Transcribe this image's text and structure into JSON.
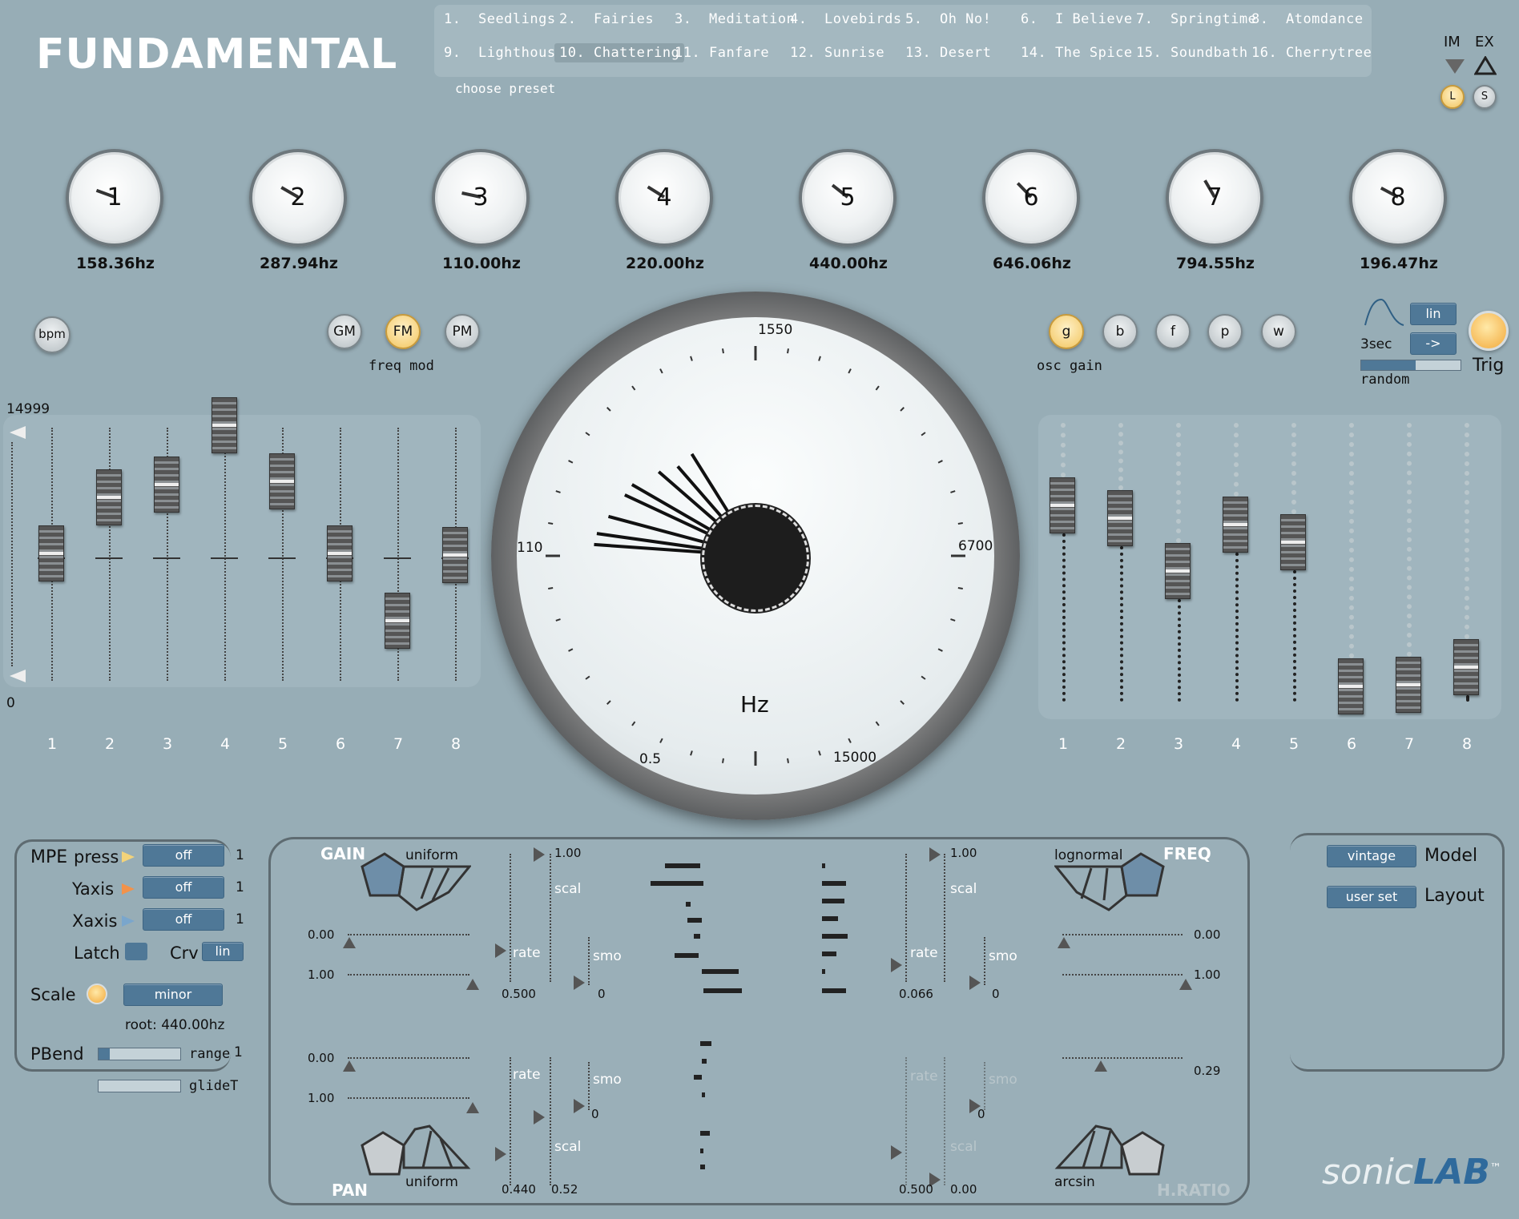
{
  "app": {
    "title": "FUNDAMENTAL",
    "brand_a": "sonic",
    "brand_b": "LAB",
    "brand_tm": "™"
  },
  "presets": {
    "items": [
      {
        "num": "1.",
        "name": "Seedlings"
      },
      {
        "num": "2.",
        "name": "Fairies"
      },
      {
        "num": "3.",
        "name": "Meditation"
      },
      {
        "num": "4.",
        "name": "Lovebirds"
      },
      {
        "num": "5.",
        "name": "Oh No!"
      },
      {
        "num": "6.",
        "name": "I Believe"
      },
      {
        "num": "7.",
        "name": "Springtime"
      },
      {
        "num": "8.",
        "name": "Atomdance"
      },
      {
        "num": "9.",
        "name": "Lighthouse"
      },
      {
        "num": "10.",
        "name": "Chattering"
      },
      {
        "num": "11.",
        "name": "Fanfare"
      },
      {
        "num": "12.",
        "name": "Sunrise"
      },
      {
        "num": "13.",
        "name": "Desert"
      },
      {
        "num": "14.",
        "name": "The Spice"
      },
      {
        "num": "15.",
        "name": "Soundbath"
      },
      {
        "num": "16.",
        "name": "Cherrytree"
      }
    ],
    "selected": "10. Chattering",
    "choose_label": "choose preset"
  },
  "import_export": {
    "im": "IM",
    "ex": "EX",
    "load": "L",
    "save": "S"
  },
  "oscillators": [
    {
      "label": "1",
      "freq": "158.36hz"
    },
    {
      "label": "2",
      "freq": "287.94hz"
    },
    {
      "label": "3",
      "freq": "110.00hz"
    },
    {
      "label": "4",
      "freq": "220.00hz"
    },
    {
      "label": "5",
      "freq": "440.00hz"
    },
    {
      "label": "6",
      "freq": "646.06hz"
    },
    {
      "label": "7",
      "freq": "794.55hz"
    },
    {
      "label": "8",
      "freq": "196.47hz"
    }
  ],
  "buttons": {
    "bpm": "bpm",
    "gm": "GM",
    "fm": "FM",
    "pm": "PM",
    "freq_mod": "freq mod",
    "g": "g",
    "b": "b",
    "f": "f",
    "p": "p",
    "w": "w",
    "osc_gain": "osc gain"
  },
  "trigger": {
    "curve": "lin",
    "time": "3sec",
    "arrow": "->",
    "random": "random",
    "trig": "Trig",
    "random_level": 0.55
  },
  "freq_sliders": {
    "max": "14999",
    "min": "0",
    "labels": [
      "1",
      "2",
      "3",
      "4",
      "5",
      "6",
      "7",
      "8"
    ]
  },
  "gain_sliders": {
    "labels": [
      "1",
      "2",
      "3",
      "4",
      "5",
      "6",
      "7",
      "8"
    ]
  },
  "dial": {
    "unit": "Hz",
    "tick_1550": "1550",
    "tick_110": "110",
    "tick_6700": "6700",
    "tick_05": "0.5",
    "tick_15000": "15000"
  },
  "mpe": {
    "title": "MPE",
    "press": "press",
    "yaxis": "Yaxis",
    "xaxis": "Xaxis",
    "press_val": "off",
    "yaxis_val": "off",
    "xaxis_val": "off",
    "press_num": "1",
    "yaxis_num": "1",
    "xaxis_num": "1",
    "latch": "Latch",
    "crv": "Crv",
    "crv_val": "lin",
    "scale": "Scale",
    "scale_val": "minor",
    "root": "root: 440.00hz",
    "pbend": "PBend",
    "range": "range",
    "range_val": "1",
    "glide": "glideT"
  },
  "model": {
    "model_val": "vintage",
    "model_label": "Model",
    "layout_val": "user set",
    "layout_label": "Layout"
  },
  "gain_section": {
    "label": "GAIN",
    "dist": "uniform",
    "scal_val": "1.00",
    "scal": "scal",
    "min": "0.00",
    "max": "1.00",
    "rate": "rate",
    "rate_val": "0.500",
    "smo": "smo",
    "smo_val": "0"
  },
  "freq_section": {
    "label": "FREQ",
    "dist": "lognormal",
    "scal_val": "1.00",
    "scal": "scal",
    "min": "0.00",
    "max": "1.00",
    "rate": "rate",
    "rate_val": "0.066",
    "smo": "smo",
    "smo_val": "0"
  },
  "pan_section": {
    "label": "PAN",
    "dist": "uniform",
    "min": "0.00",
    "max": "1.00",
    "rate": "rate",
    "smo": "smo",
    "smo_val": "0",
    "scal": "scal",
    "scal_a": "0.440",
    "scal_b": "0.52"
  },
  "hratio_section": {
    "label": "H.RATIO",
    "dist": "arcsin",
    "value": "0.29",
    "rate": "rate",
    "smo": "smo",
    "smo_val": "0",
    "scal": "scal",
    "scal_a": "0.500",
    "scal_b": "0.00"
  }
}
